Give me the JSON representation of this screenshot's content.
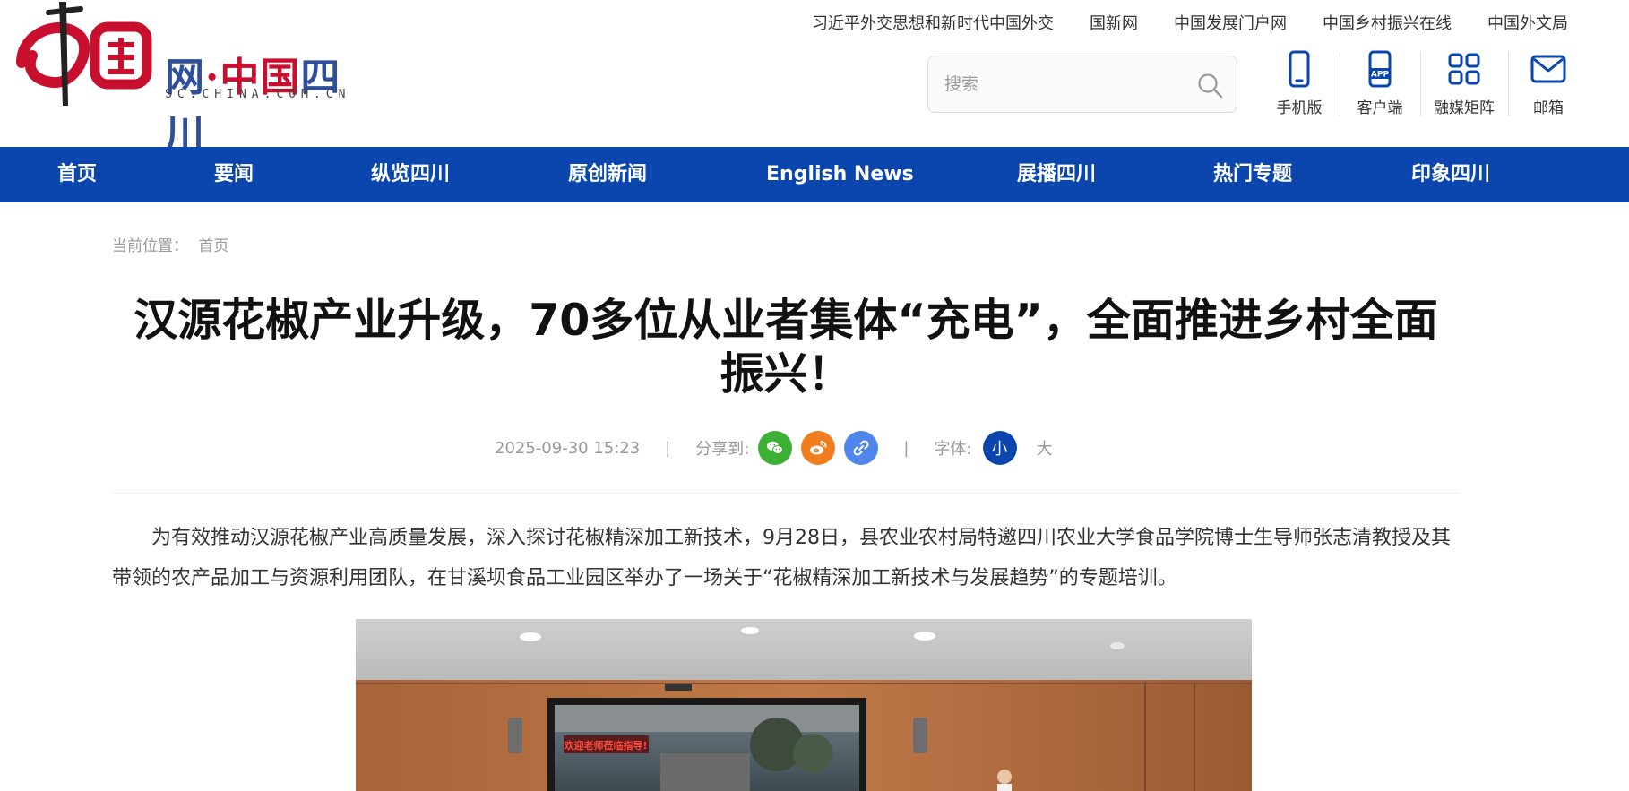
{
  "header": {
    "logo": {
      "net": "网",
      "dot": "·",
      "region_a": "中国",
      "region_b": "四川",
      "domain": "SC.CHINA.COM.CN"
    },
    "top_links": [
      "习近平外交思想和新时代中国外交",
      "国新网",
      "中国发展门户网",
      "中国乡村振兴在线",
      "中国外文局"
    ],
    "search": {
      "placeholder": "搜索"
    },
    "tools": [
      {
        "label": "手机版",
        "icon": "mobile-icon"
      },
      {
        "label": "客户端",
        "icon": "app-icon",
        "badge": "APP"
      },
      {
        "label": "融媒矩阵",
        "icon": "grid-icon"
      },
      {
        "label": "邮箱",
        "icon": "mail-icon"
      }
    ]
  },
  "nav": {
    "items": [
      "首页",
      "要闻",
      "纵览四川",
      "原创新闻",
      "English News",
      "展播四川",
      "热门专题",
      "印象四川"
    ]
  },
  "breadcrumb": {
    "prefix": "当前位置：",
    "current": "首页"
  },
  "article": {
    "title": "汉源花椒产业升级，70多位从业者集体“充电”，全面推进乡村全面振兴！",
    "datetime": "2025-09-30 15:23",
    "share_label": "分享到:",
    "font_label": "字体:",
    "font_small": "小",
    "font_large": "大",
    "paragraph": "为有效推动汉源花椒产业高质量发展，深入探讨花椒精深加工新技术，9月28日，县农业农村局特邀四川农业大学食品学院博士生导师张志清教授及其带领的农产品加工与资源利用团队，在甘溪坝食品工业园区举办了一场关于“花椒精深加工新技术与发展趋势”的专题培训。",
    "photo_screen_text": "欢迎老师莅临指导!"
  },
  "colors": {
    "nav_bg": "#0a46ad",
    "brand_red": "#c8102e",
    "brand_blue": "#2f4f9a",
    "wechat": "#3cb035",
    "weibo": "#f07e1e",
    "link": "#4f86ec"
  }
}
